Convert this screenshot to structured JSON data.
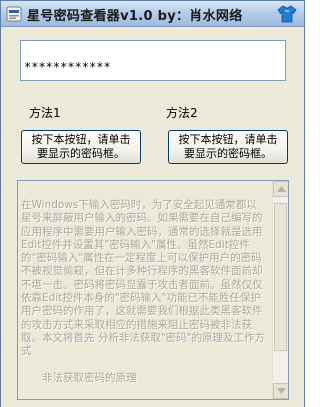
{
  "window": {
    "title": "星号密码查看器v1.0   by：肖水网络"
  },
  "password": {
    "value": "************"
  },
  "methods": [
    {
      "label": "方法1",
      "button_label": "按下本按钮，请单击\n要显示的密码框。"
    },
    {
      "label": "方法2",
      "button_label": "按下本按钮，请单击\n要显示的密码框。"
    }
  ],
  "description": {
    "text": "        在Windows下输入密码时，为了安全起见通常都以星号来屏蔽用户输入的密码。如果需要在自己编写的应用程序中需要用户输入密码，通常的选择就是选用Edit控件并设置其\"密码输入\"属性。虽然Edit控件的\"密码输入\"属性在一定程度上可以保护用户的密码不被视觉偷窥，但在计多种行程序的黑客软件面前却不堪一击。密码将密码显露于攻击者面前。虽然仅仅依靠Edit控件本身的\"密码输入\"功能已不能胜任保护用户密码的作用了，这就需要我们根据此类黑客软件的攻击方式来采取相应的措施来阻止密码被非法获取。本文将首先 分析非法获取\"密码\"的原理及工作方式",
    "subheading": "非法获取密码的原理"
  },
  "colors": {
    "titlebar": "#b6cde9",
    "window_bg": "#ece9d8",
    "button_border": "#003c74",
    "disabled_text": "#a9a797"
  }
}
